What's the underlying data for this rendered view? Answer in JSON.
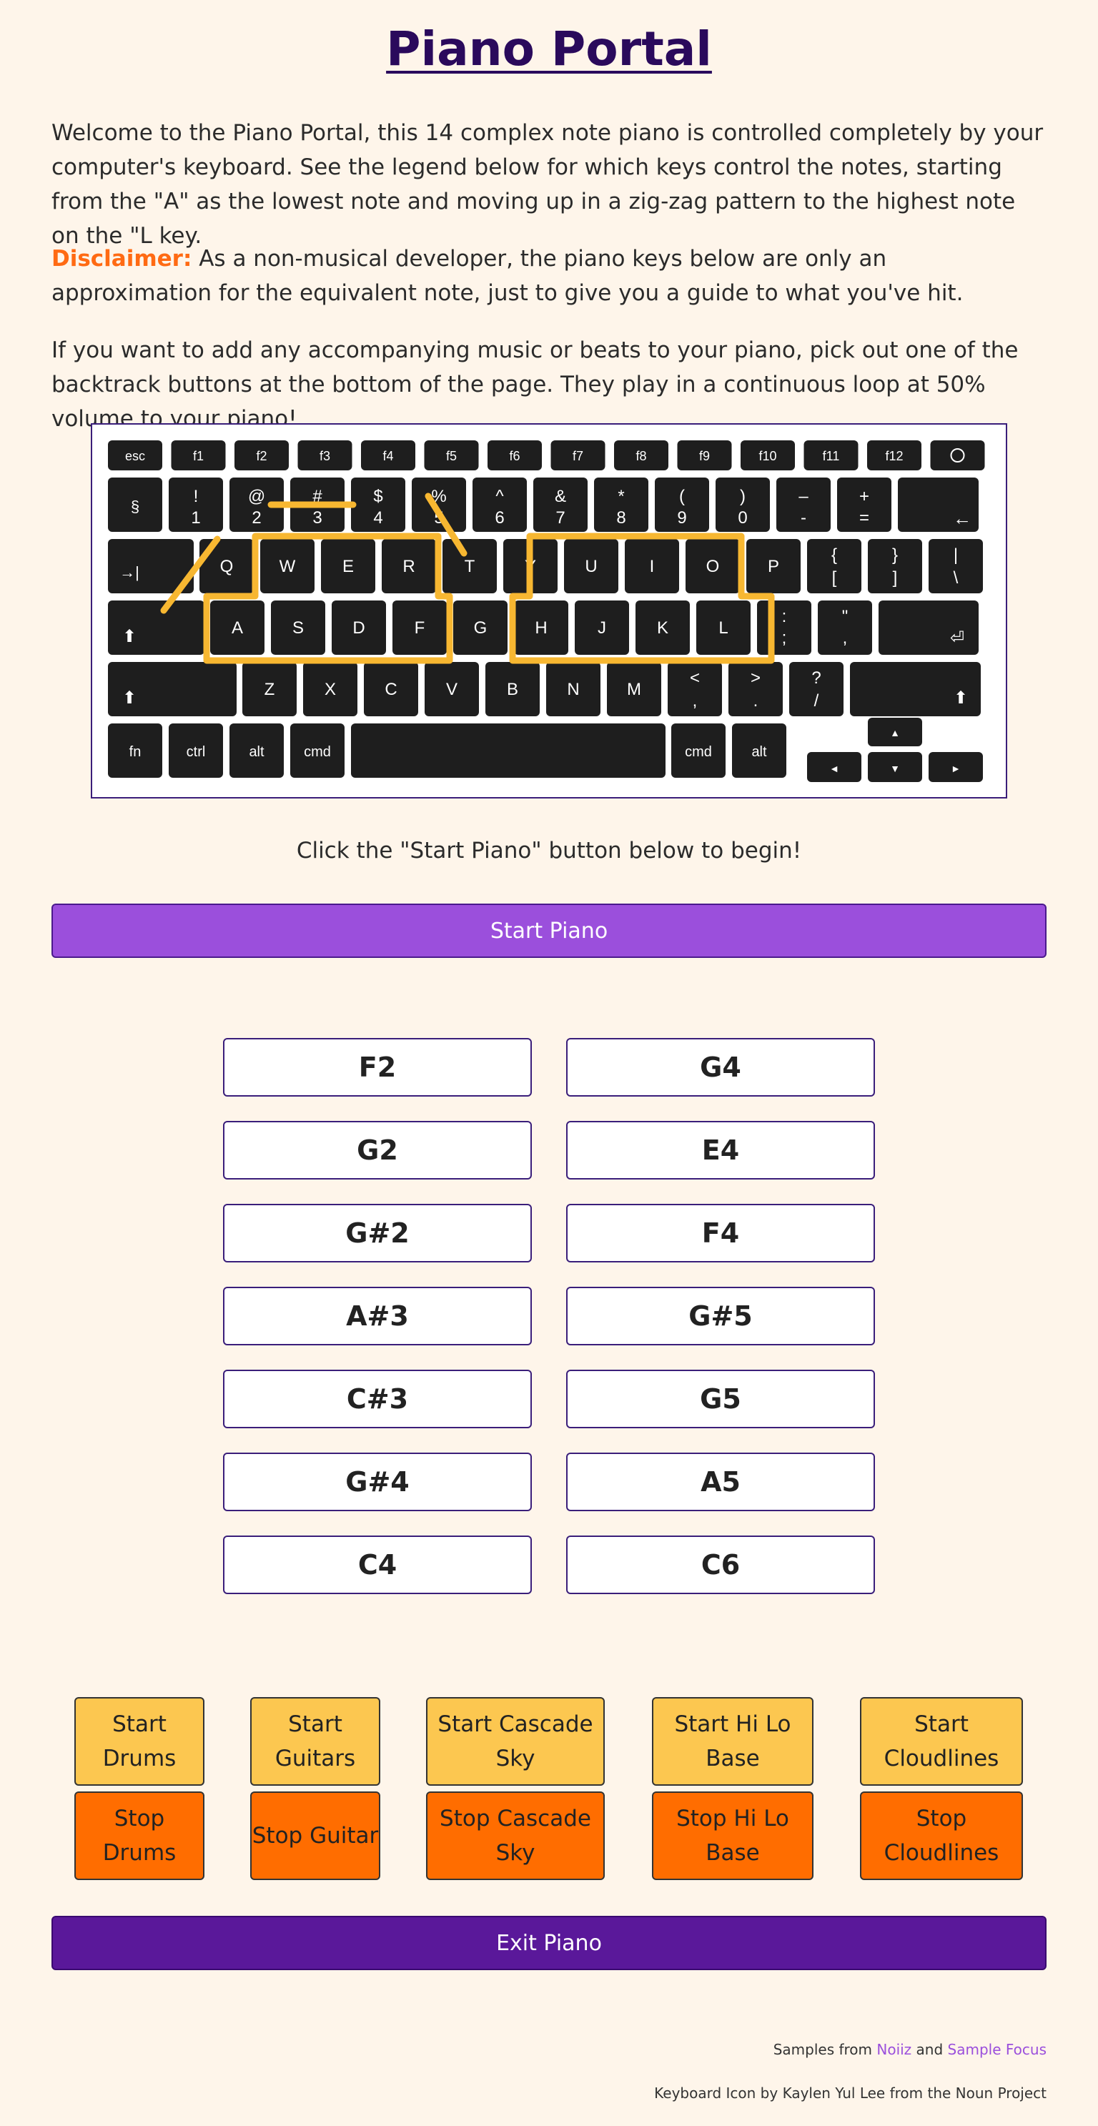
{
  "title": "Piano Portal",
  "intro": "Welcome to the Piano Portal, this 14 complex note piano is controlled completely by your computer's keyboard. See the legend below for which keys control the notes, starting from the \"A\" as the lowest note and moving up in a zig-zag pattern to the highest note on the \"L key.",
  "disclaimer_label": "Disclaimer:",
  "disclaimer_text": " As a non-musical developer, the piano keys below are only an approximation for the equivalent note, just to give you a guide to what you've hit.",
  "backtrack_text": "If you want to add any accompanying music or beats to your piano, pick out one of the backtrack buttons at the bottom of the page. They play in a continuous loop at 50% volume to your piano!",
  "keyboard_image": {
    "row0": [
      "esc",
      "f1",
      "f2",
      "f3",
      "f4",
      "f5",
      "f6",
      "f7",
      "f8",
      "f9",
      "f10",
      "f11",
      "f12"
    ],
    "row1_top": [
      "!",
      "@",
      "#",
      "$",
      "%",
      "^",
      "&",
      "*",
      "(",
      ")",
      "–",
      "+"
    ],
    "row1_bottom": [
      "1",
      "2",
      "3",
      "4",
      "5",
      "6",
      "7",
      "8",
      "9",
      "0",
      "-",
      "="
    ],
    "row1_first": "§",
    "row2": [
      "Q",
      "W",
      "E",
      "R",
      "T",
      "Y",
      "U",
      "I",
      "O",
      "P"
    ],
    "row2_extra_top": [
      "{",
      "}",
      "|"
    ],
    "row2_extra_bottom": [
      "[",
      "]",
      "\\"
    ],
    "row3": [
      "A",
      "S",
      "D",
      "F",
      "G",
      "H",
      "J",
      "K",
      "L"
    ],
    "row3_extra_top": [
      ":",
      "\""
    ],
    "row3_extra_bottom": [
      ";",
      ","
    ],
    "row4": [
      "Z",
      "X",
      "C",
      "V",
      "B",
      "N",
      "M"
    ],
    "row4_extra_top": [
      "<",
      ">",
      "?"
    ],
    "row4_extra_bottom": [
      ",",
      ".",
      "/"
    ],
    "row5": [
      "fn",
      "ctrl",
      "alt",
      "cmd"
    ],
    "row5_right": [
      "cmd",
      "alt"
    ],
    "highlight_color": "#f7b731"
  },
  "click_message": "Click the \"Start Piano\" button below to begin!",
  "start_piano": "Start Piano",
  "notes_left": [
    "F2",
    "G2",
    "G#2",
    "A#3",
    "C#3",
    "G#4",
    "C4"
  ],
  "notes_right": [
    "G4",
    "E4",
    "F4",
    "G#5",
    "G5",
    "A5",
    "C6"
  ],
  "tracks": [
    {
      "start": "Start Drums",
      "stop": "Stop Drums"
    },
    {
      "start": "Start Guitars",
      "stop": "Stop Guitar"
    },
    {
      "start": "Start Cascade Sky",
      "stop": "Stop Cascade Sky"
    },
    {
      "start": "Start Hi Lo Base",
      "stop": "Stop Hi Lo Base"
    },
    {
      "start": "Start Cloudlines",
      "stop": "Stop Cloudlines"
    }
  ],
  "exit_piano": "Exit Piano",
  "footer": {
    "samples_prefix": "Samples from ",
    "link1": "Noiiz",
    "and": " and ",
    "link2": "Sample Focus",
    "credit": "Keyboard Icon by Kaylen Yul Lee from the Noun Project"
  },
  "colors": {
    "background": "#fef5ea",
    "title": "#2a0a5c",
    "start_piano": "#9b4fdc",
    "exit_piano": "#5a189a",
    "track_start": "#fcc750",
    "track_stop": "#ff6d00",
    "disclaimer": "#ff6a13"
  }
}
